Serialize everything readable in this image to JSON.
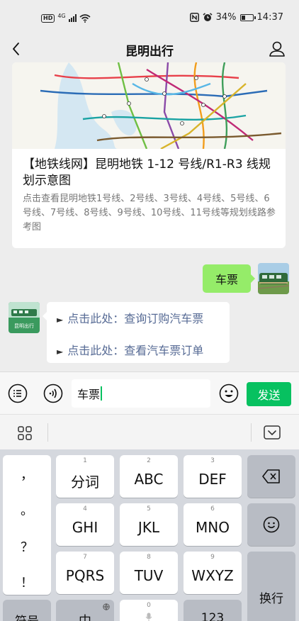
{
  "status_bar": {
    "network": "4G",
    "battery_text": "34%",
    "battery_level": 0.34,
    "time": "14:37"
  },
  "nav": {
    "title": "昆明出行",
    "back_icon": "chevron-left-icon",
    "profile_icon": "person-icon"
  },
  "chat": {
    "article": {
      "title": "【地铁线网】昆明地铁 1-12 号线/R1-R3 线规划示意图",
      "description": "点击查看昆明地铁1号线、2号线、3号线、4号线、5号线、6号线、7号线、8号线、9号线、10号线、11号线等规划线路参考图"
    },
    "user_message": "车票",
    "bot_avatar_text": "昆明出行",
    "bot_links": [
      "点击此处：查询订购汽车票",
      "点击此处：查看汽车票订单"
    ]
  },
  "input": {
    "value": "车票",
    "send_label": "发送",
    "left_icons": [
      "menu-list-icon",
      "voice-icon"
    ],
    "right_icon": "emoji-icon"
  },
  "keyboard_toolbar": {
    "left_icon": "grid-icon",
    "right_icon": "collapse-keyboard-icon"
  },
  "keyboard": {
    "punctuation": [
      "，",
      "。",
      "？",
      "！"
    ],
    "keys": [
      {
        "num": "1",
        "label": "分词"
      },
      {
        "num": "2",
        "label": "ABC"
      },
      {
        "num": "3",
        "label": "DEF"
      },
      {
        "num": "4",
        "label": "GHI"
      },
      {
        "num": "5",
        "label": "JKL"
      },
      {
        "num": "6",
        "label": "MNO"
      },
      {
        "num": "7",
        "label": "PQRS"
      },
      {
        "num": "8",
        "label": "TUV"
      },
      {
        "num": "9",
        "label": "WXYZ"
      },
      {
        "num": "0",
        "label": ""
      }
    ],
    "symbol_label": "符号",
    "chinese_label": "中",
    "numeric_label": "123",
    "enter_label": "换行",
    "backspace_icon": "backspace-icon",
    "emoji_icon": "smiley-icon"
  },
  "colors": {
    "accent": "#07c160",
    "bubble_green": "#95ec69",
    "link": "#576b95",
    "background": "#ededed"
  }
}
